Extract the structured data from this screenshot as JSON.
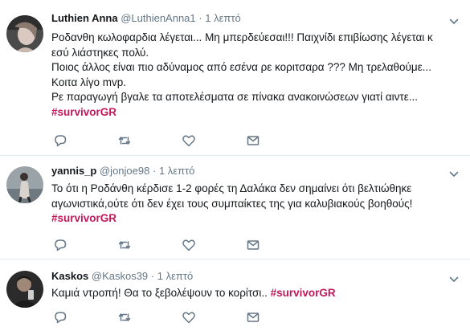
{
  "tweets": [
    {
      "name": "Luthien Anna",
      "handle": "@LuthienAnna1",
      "time": "1 λεπτό",
      "lines": [
        "Ροδανθη κωλοφαρδια λέγεται... Μη μπερδεύεσαι!!! Παιχνίδι επιβίωσης λέγεται κ",
        "εσύ λιάστηκες πολύ.",
        "Ποιος άλλος είναι πιο αδύναμος από εσένα ρε κοριτσαρα ??? Μη τρελαθούμε...",
        "Κοιτα λίγο mvp.",
        "Ρε παραγωγή βγαλε τα αποτελέσματα σε πίνακα ανακοινώσεων γιατί αιντε..."
      ],
      "hashtag": "#survivorGR"
    },
    {
      "name": "yannis_p",
      "handle": "@jonjoe98",
      "time": "1 λεπτό",
      "lines": [
        "Το ότι η Ροδάνθη κέρδισε 1-2 φορές τη Δαλάκα δεν σημαίνει ότι βελτιώθηκε",
        "αγωνιστικά,ούτε ότι δεν έχει τους συμπαίκτες της για καλυβιακούς βοηθούς!"
      ],
      "hashtag": "#survivorGR"
    },
    {
      "name": "Kaskos",
      "handle": "@Kaskos39",
      "time": "1 λεπτό",
      "text": "Καμιά ντροπή! Θα το ξεβολέψουν το κορίτσι.. ",
      "hashtag": "#survivorGR"
    }
  ],
  "separator": "·",
  "icons": [
    "chevron-down-icon",
    "reply-icon",
    "retweet-icon",
    "heart-icon",
    "envelope-icon"
  ],
  "colors": {
    "hashtag": "#c2185b",
    "meta": "#657786",
    "text": "#14171a",
    "divider": "#e6ecf0"
  }
}
